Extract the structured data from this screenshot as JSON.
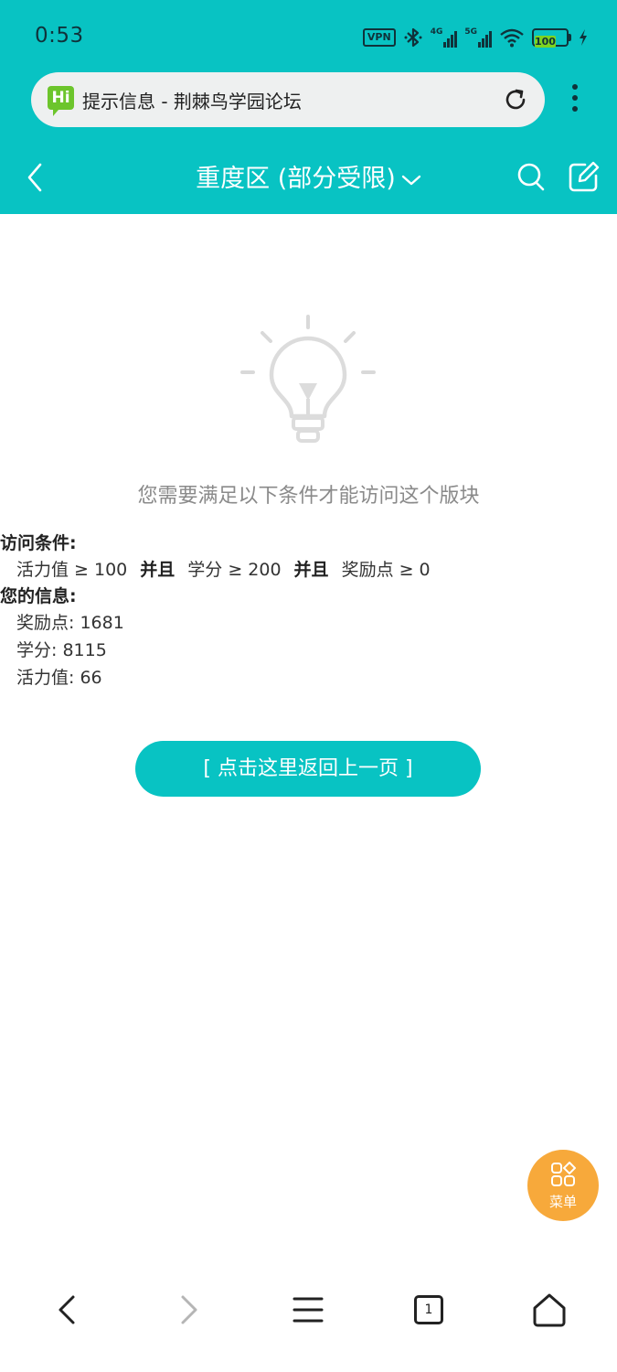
{
  "status_bar": {
    "time": "0:53",
    "vpn": "VPN",
    "net1": "4G",
    "net2": "5G",
    "battery": "100"
  },
  "browser": {
    "site_logo": "Hi",
    "page_title": "提示信息 - 荆棘鸟学园论坛"
  },
  "forum_nav": {
    "title": "重度区 (部分受限)"
  },
  "content": {
    "notice": "您需要满足以下条件才能访问这个版块",
    "conditions_heading": "访问条件:",
    "conditions": {
      "c1": "活力值 ≥ 100",
      "and1": "并且",
      "c2": "学分 ≥ 200",
      "and2": "并且",
      "c3": "奖励点 ≥ 0"
    },
    "your_info_heading": "您的信息:",
    "your_info": {
      "reward": "奖励点: 1681",
      "credit": "学分: 8115",
      "vitality": "活力值: 66"
    },
    "back_button": "[ 点击这里返回上一页 ]"
  },
  "menu_fab": {
    "label": "菜单"
  },
  "bottom_bar": {
    "tab_count": "1"
  },
  "colors": {
    "accent": "#08c3c3",
    "fab": "#f7a93b"
  }
}
